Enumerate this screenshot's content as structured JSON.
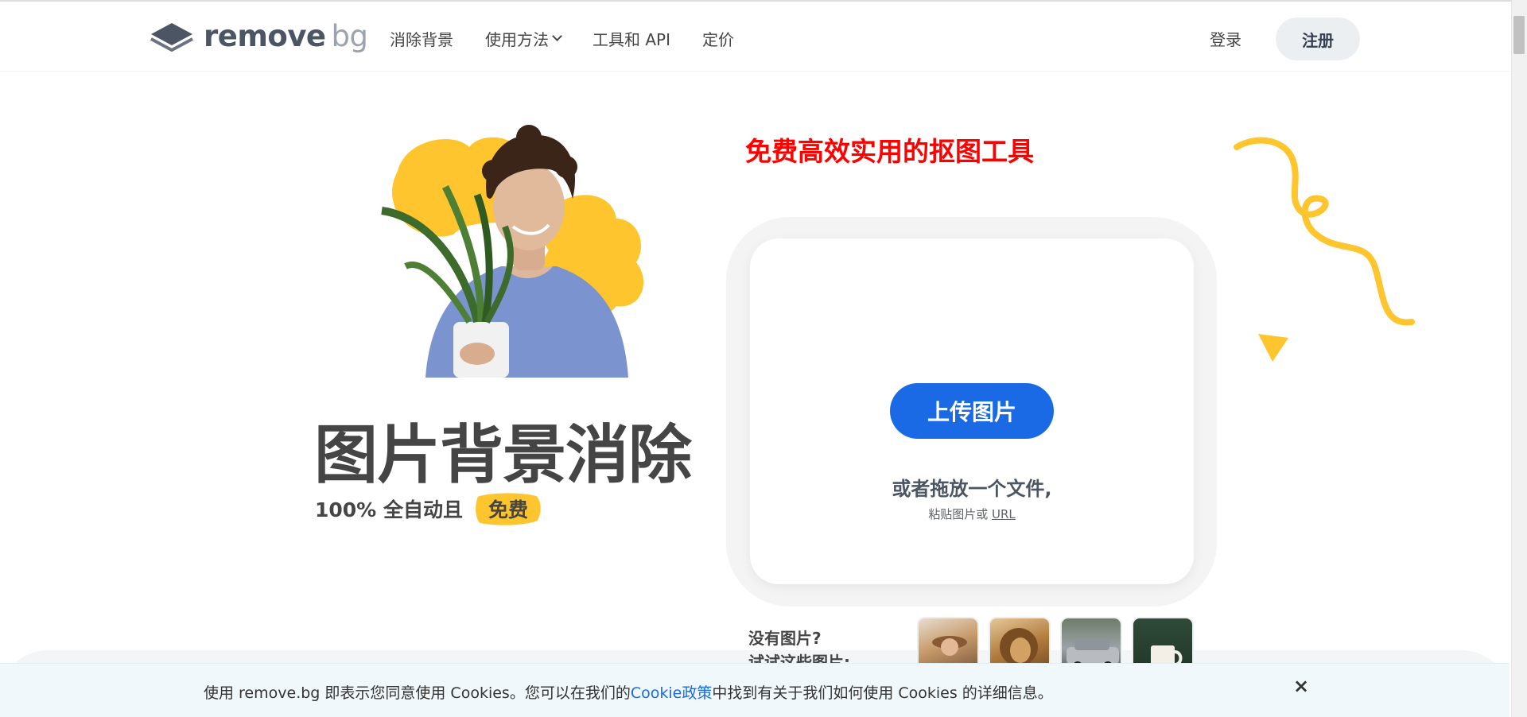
{
  "header": {
    "logo_main": "remove",
    "logo_accent": "bg",
    "nav": [
      {
        "label": "消除背景"
      },
      {
        "label": "使用方法"
      },
      {
        "label": "工具和 API"
      },
      {
        "label": "定价"
      }
    ],
    "login_label": "登录",
    "signup_label": "注册"
  },
  "hero": {
    "tagline": "免费高效实用的抠图工具",
    "title": "图片背景消除",
    "subtitle": "100% 全自动且",
    "free_badge": "免费"
  },
  "upload": {
    "button_label": "上传图片",
    "drop_text": "或者拖放一个文件,",
    "paste_prefix": "粘贴图片或",
    "url_label": "URL"
  },
  "samples": {
    "prompt_line1": "没有图片?",
    "prompt_line2": "试试这些图片:",
    "items": [
      {
        "name": "woman-with-hat-sample"
      },
      {
        "name": "lion-sample"
      },
      {
        "name": "car-sample"
      },
      {
        "name": "coffee-mug-sample"
      }
    ]
  },
  "cookie": {
    "text_before": "使用 remove.bg 即表示您同意使用 Cookies。您可以在我们的",
    "link_label": "Cookie政策",
    "text_after": "中找到有关于我们如何使用 Cookies 的详细信息。",
    "close_glyph": "×"
  },
  "colors": {
    "accent_blue": "#1a6ae6",
    "brand_yellow": "#ffc52e",
    "tagline_red": "#ff0000"
  }
}
